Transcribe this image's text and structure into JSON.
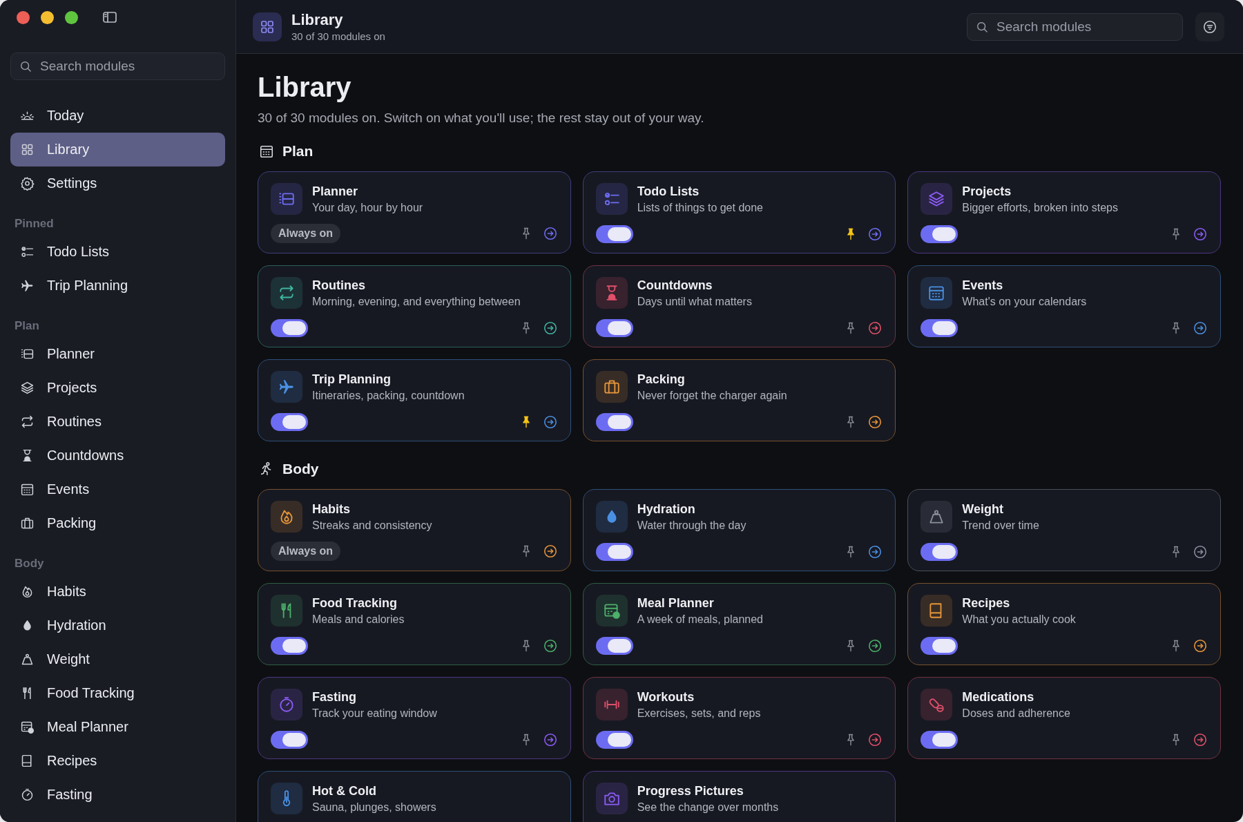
{
  "sidebar": {
    "search": {
      "placeholder": "Search modules"
    },
    "groups": [
      {
        "items": [
          {
            "label": "Today",
            "selected": false
          },
          {
            "label": "Library",
            "selected": true
          },
          {
            "label": "Settings",
            "selected": false
          }
        ]
      },
      {
        "label": "Pinned",
        "items": [
          {
            "label": "Todo Lists",
            "selected": false
          },
          {
            "label": "Trip Planning",
            "selected": false
          }
        ]
      },
      {
        "label": "Plan",
        "items": [
          {
            "label": "Planner",
            "selected": false
          },
          {
            "label": "Projects",
            "selected": false
          },
          {
            "label": "Routines",
            "selected": false
          },
          {
            "label": "Countdowns",
            "selected": false
          },
          {
            "label": "Events",
            "selected": false
          },
          {
            "label": "Packing",
            "selected": false
          }
        ]
      },
      {
        "label": "Body",
        "items": [
          {
            "label": "Habits",
            "selected": false
          },
          {
            "label": "Hydration",
            "selected": false
          },
          {
            "label": "Weight",
            "selected": false
          },
          {
            "label": "Food Tracking",
            "selected": false
          },
          {
            "label": "Meal Planner",
            "selected": false
          },
          {
            "label": "Recipes",
            "selected": false
          },
          {
            "label": "Fasting",
            "selected": false
          }
        ]
      }
    ]
  },
  "header": {
    "title": "Library",
    "subtitle": "30 of 30 modules on",
    "search": {
      "placeholder": "Search modules"
    }
  },
  "page": {
    "title": "Library",
    "subtitle": "30 of 30 modules on. Switch on what you'll use; the rest stay out of your way."
  },
  "sections": [
    {
      "title": "Plan",
      "modules": [
        {
          "title": "Planner",
          "subtitle": "Your day, hour by hour",
          "color": "#6d6cf2",
          "control": {
            "kind": "badge",
            "label": "Always on"
          },
          "pinned": false
        },
        {
          "title": "Todo Lists",
          "subtitle": "Lists of things to get done",
          "color": "#6d6cf2",
          "control": {
            "kind": "toggle",
            "on": true
          },
          "pinned": true
        },
        {
          "title": "Projects",
          "subtitle": "Bigger efforts, broken into steps",
          "color": "#8b5cf6",
          "control": {
            "kind": "toggle",
            "on": true
          },
          "pinned": false
        },
        {
          "title": "Routines",
          "subtitle": "Morning, evening, and everything between",
          "color": "#3fb5a0",
          "control": {
            "kind": "toggle",
            "on": true
          },
          "pinned": false
        },
        {
          "title": "Countdowns",
          "subtitle": "Days until what matters",
          "color": "#e0506a",
          "control": {
            "kind": "toggle",
            "on": true
          },
          "pinned": false
        },
        {
          "title": "Events",
          "subtitle": "What's on your calendars",
          "color": "#4a90e2",
          "control": {
            "kind": "toggle",
            "on": true
          },
          "pinned": false
        },
        {
          "title": "Trip Planning",
          "subtitle": "Itineraries, packing, countdown",
          "color": "#4a90e2",
          "control": {
            "kind": "toggle",
            "on": true
          },
          "pinned": true
        },
        {
          "title": "Packing",
          "subtitle": "Never forget the charger again",
          "color": "#e8963a",
          "control": {
            "kind": "toggle",
            "on": true
          },
          "pinned": false
        }
      ]
    },
    {
      "title": "Body",
      "modules": [
        {
          "title": "Habits",
          "subtitle": "Streaks and consistency",
          "color": "#e8963a",
          "control": {
            "kind": "badge",
            "label": "Always on"
          },
          "pinned": false
        },
        {
          "title": "Hydration",
          "subtitle": "Water through the day",
          "color": "#4a90e2",
          "control": {
            "kind": "toggle",
            "on": true
          },
          "pinned": false
        },
        {
          "title": "Weight",
          "subtitle": "Trend over time",
          "color": "#8a8f9c",
          "control": {
            "kind": "toggle",
            "on": true
          },
          "pinned": false
        },
        {
          "title": "Food Tracking",
          "subtitle": "Meals and calories",
          "color": "#4caf6a",
          "control": {
            "kind": "toggle",
            "on": true
          },
          "pinned": false
        },
        {
          "title": "Meal Planner",
          "subtitle": "A week of meals, planned",
          "color": "#4caf6a",
          "control": {
            "kind": "toggle",
            "on": true
          },
          "pinned": false
        },
        {
          "title": "Recipes",
          "subtitle": "What you actually cook",
          "color": "#e8963a",
          "control": {
            "kind": "toggle",
            "on": true
          },
          "pinned": false
        },
        {
          "title": "Fasting",
          "subtitle": "Track your eating window",
          "color": "#8b5cf6",
          "control": {
            "kind": "toggle",
            "on": true
          },
          "pinned": false
        },
        {
          "title": "Workouts",
          "subtitle": "Exercises, sets, and reps",
          "color": "#e0506a",
          "control": {
            "kind": "toggle",
            "on": true
          },
          "pinned": false
        },
        {
          "title": "Medications",
          "subtitle": "Doses and adherence",
          "color": "#e0506a",
          "control": {
            "kind": "toggle",
            "on": true
          },
          "pinned": false
        },
        {
          "title": "Hot & Cold",
          "subtitle": "Sauna, plunges, showers",
          "color": "#4a90e2"
        },
        {
          "title": "Progress Pictures",
          "subtitle": "See the change over months",
          "color": "#8b5cf6"
        }
      ]
    }
  ]
}
